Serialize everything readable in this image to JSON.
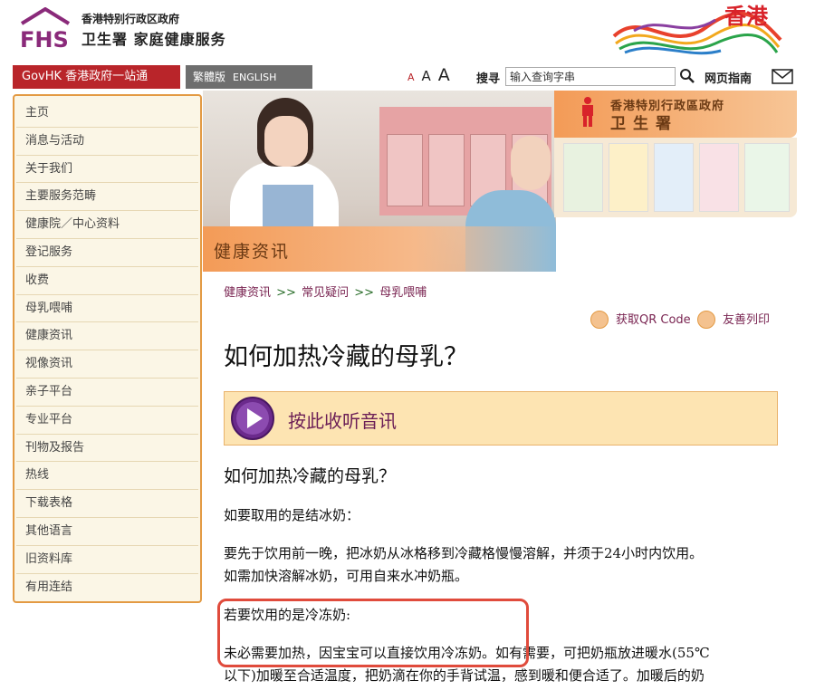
{
  "header": {
    "logo_line1": "香港特别行政区政府",
    "logo_line2": "卫生署 家庭健康服务",
    "brand_hk": "香港"
  },
  "topbar": {
    "govhk": "GovHK 香港政府一站通",
    "lang_trad": "繁體版",
    "lang_en": "ENGLISH",
    "font_small": "A",
    "font_medium": "A",
    "font_large": "A",
    "search_label": "搜寻",
    "search_value": "输入查询字串",
    "sitemap": "网页指南"
  },
  "sidebar": {
    "items": [
      {
        "label": "主页"
      },
      {
        "label": "消息与活动"
      },
      {
        "label": "关于我们"
      },
      {
        "label": "主要服务范畴"
      },
      {
        "label": "健康院／中心资料"
      },
      {
        "label": "登记服务"
      },
      {
        "label": "收费"
      },
      {
        "label": "母乳喂哺"
      },
      {
        "label": "健康资讯"
      },
      {
        "label": "视像资讯"
      },
      {
        "label": "亲子平台"
      },
      {
        "label": "专业平台"
      },
      {
        "label": "刊物及报告"
      },
      {
        "label": "热线"
      },
      {
        "label": "下载表格"
      },
      {
        "label": "其他语言"
      },
      {
        "label": "旧资料库"
      },
      {
        "label": "有用连结"
      }
    ]
  },
  "banner": {
    "caption": "健康资讯",
    "dh_line1": "香港特別行政區政府",
    "dh_line2": "卫生署"
  },
  "breadcrumb": {
    "item1": "健康资讯",
    "sep": ">>",
    "item2": "常见疑问",
    "item3": "母乳喂哺"
  },
  "tools": {
    "qr": "获取QR Code",
    "print": "友善列印"
  },
  "content": {
    "title": "如何加热冷藏的母乳？",
    "audio_label": "按此收听音讯",
    "subtitle": "如何加热冷藏的母乳？",
    "p1": "如要取用的是结冰奶：",
    "p2_line1": "要先于饮用前一晚，把冰奶从冰格移到冷藏格慢慢溶解，并须于24小时内饮用。",
    "p2_line2": "如需加快溶解冰奶，可用自来水冲奶瓶。",
    "p3": "若要饮用的是冷冻奶:",
    "p4_line1": "未必需要加热，因宝宝可以直接饮用冷冻奶。如有需要，可把奶瓶放进暖水(55℃",
    "p4_line2": "以下)加暖至合适温度，把奶滴在你的手背试温，感到暖和便合适了。加暖后的奶"
  },
  "colors": {
    "sidebar_border": "#e39a43",
    "sidebar_bg": "#fbf6e6",
    "govhk_red": "#b9252a",
    "link_purple": "#7a2552",
    "audio_bg": "#fde4b2",
    "highlight_red": "#e04b3c"
  }
}
